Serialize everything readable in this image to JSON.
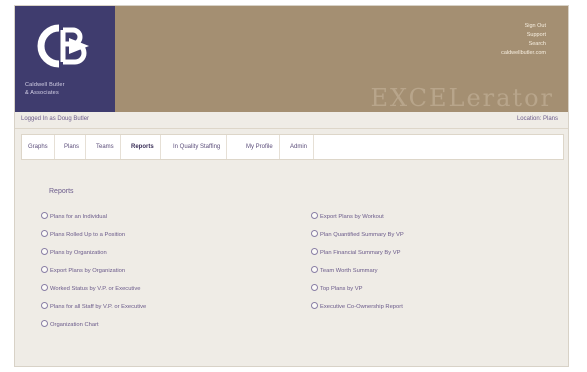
{
  "logo": {
    "monogram": "CB",
    "tagline": [
      "Caldwell Butler",
      "& Associates"
    ]
  },
  "header": {
    "links": [
      "Sign Out",
      "Support",
      "Search",
      "caldwellbutler.com"
    ],
    "brand": "EXCELerator"
  },
  "status": {
    "logged_in": "Logged In as Doug Butler",
    "location": "Location: Plans"
  },
  "tabs": [
    {
      "label": "Graphs"
    },
    {
      "label": "Plans"
    },
    {
      "label": "Teams"
    },
    {
      "label": "Reports",
      "active": true
    },
    {
      "label": "In Quality Staffing"
    },
    {
      "label": "My Profile"
    },
    {
      "label": "Admin"
    }
  ],
  "reports": {
    "title": "Reports",
    "left": [
      "Plans for an Individual",
      "Plans Rolled Up to a Position",
      "Plans by Organization",
      "Export Plans by Organization",
      "Worked Status by V.P. or Executive",
      "Plans for all Staff by V.P. or Executive",
      "Organization Chart"
    ],
    "right": [
      "Export Plans by Workout",
      "Plan Quantified Summary By VP",
      "Plan Financial Summary By VP",
      "Team Worth Summary",
      "Top Plans by VP",
      "Executive Co-Ownership Report"
    ]
  },
  "colors": {
    "header_bg": "#a48f72",
    "logo_bg": "#3f3c6e",
    "page_bg": "#efece6",
    "link_text": "#6a5a8a"
  }
}
